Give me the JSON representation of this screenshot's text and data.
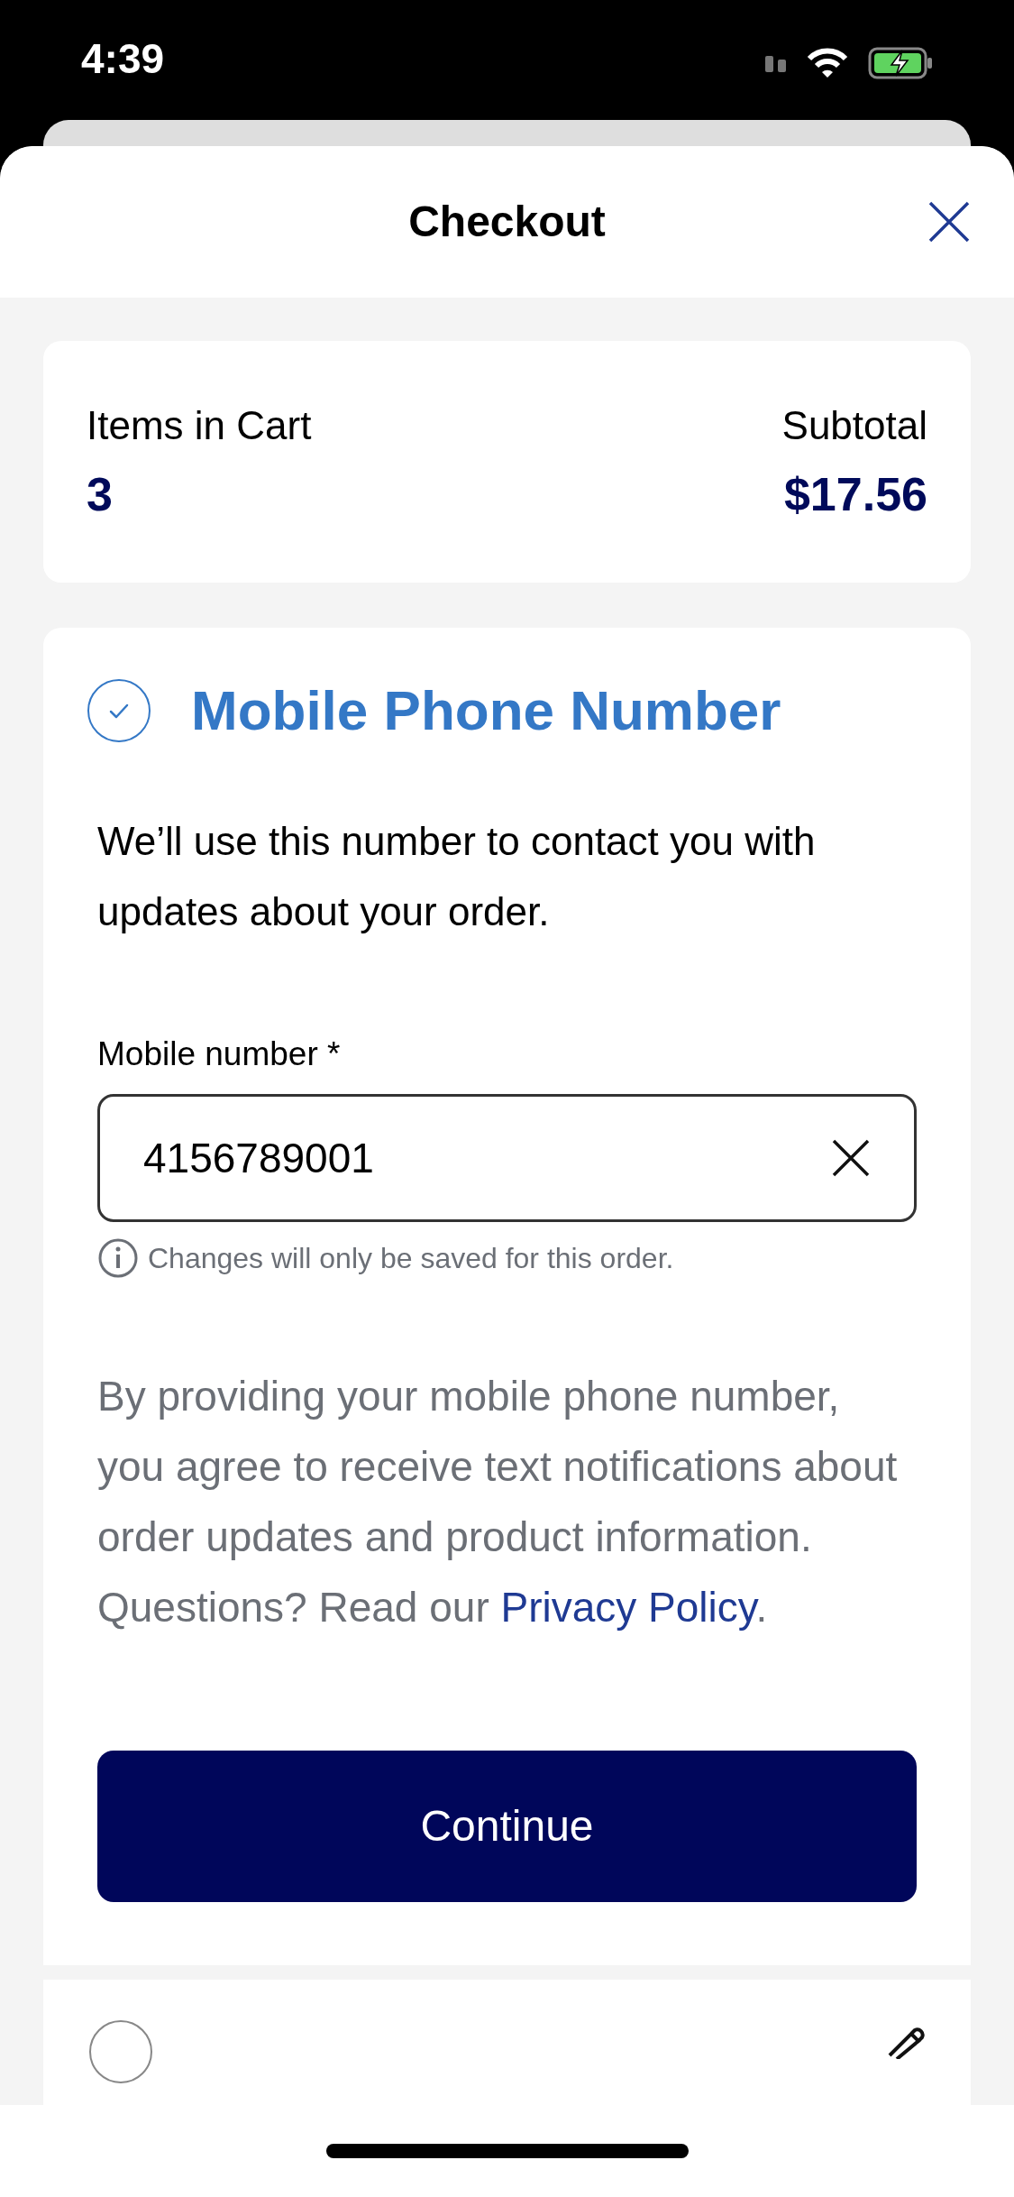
{
  "status_bar": {
    "time": "4:39"
  },
  "header": {
    "title": "Checkout"
  },
  "cart_summary": {
    "items_label": "Items in Cart",
    "items_count": "3",
    "subtotal_label": "Subtotal",
    "subtotal": "$17.56"
  },
  "phone_section": {
    "title": "Mobile Phone Number",
    "completed": true,
    "description": "We’ll use this number to contact you with updates about your order.",
    "field": {
      "label": "Mobile number *",
      "value": "4156789001",
      "hint": "Changes will only be saved for this order."
    },
    "disclaimer": "By providing your mobile phone number, you agree to receive text notifications about order updates and product information.  Questions? Read our",
    "link": "Privacy Policy",
    "after_link": ".",
    "button": "Continue"
  },
  "next_section": {
    "completed": false
  }
}
